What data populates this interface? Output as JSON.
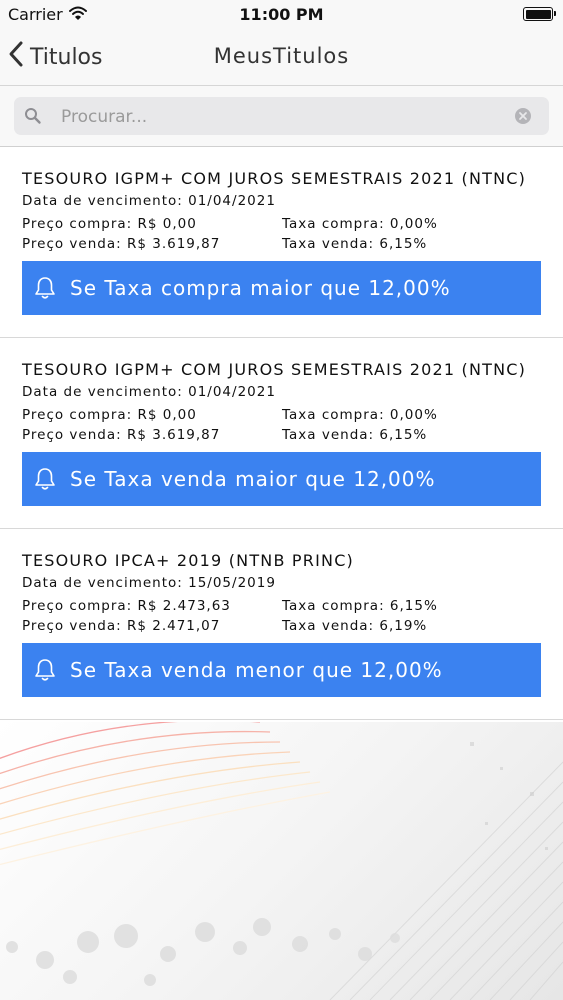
{
  "status_bar": {
    "carrier": "Carrier",
    "time": "11:00 PM"
  },
  "nav": {
    "back_label": "Titulos",
    "title": "MeusTitulos"
  },
  "search": {
    "placeholder": "Procurar..."
  },
  "colors": {
    "accent": "#3b82f0"
  },
  "alerts": [
    {
      "title": "TESOURO IGPM+ COM JUROS SEMESTRAIS 2021 (NTNC)",
      "maturity": "Data de vencimento: 01/04/2021",
      "buy_price": "Preço compra: R$ 0,00",
      "sell_price": "Preço venda: R$ 3.619,87",
      "buy_rate": "Taxa compra: 0,00%",
      "sell_rate": "Taxa venda: 6,15%",
      "alert_label": "Se Taxa compra maior que 12,00%"
    },
    {
      "title": "TESOURO IGPM+ COM JUROS SEMESTRAIS 2021 (NTNC)",
      "maturity": "Data de vencimento: 01/04/2021",
      "buy_price": "Preço compra: R$ 0,00",
      "sell_price": "Preço venda: R$ 3.619,87",
      "buy_rate": "Taxa compra: 0,00%",
      "sell_rate": "Taxa venda: 6,15%",
      "alert_label": "Se Taxa venda maior que 12,00%"
    },
    {
      "title": "TESOURO IPCA+ 2019 (NTNB PRINC)",
      "maturity": "Data de vencimento: 15/05/2019",
      "buy_price": "Preço compra: R$ 2.473,63",
      "sell_price": "Preço venda: R$ 2.471,07",
      "buy_rate": "Taxa compra: 6,15%",
      "sell_rate": "Taxa venda: 6,19%",
      "alert_label": "Se Taxa venda menor que 12,00%"
    }
  ]
}
